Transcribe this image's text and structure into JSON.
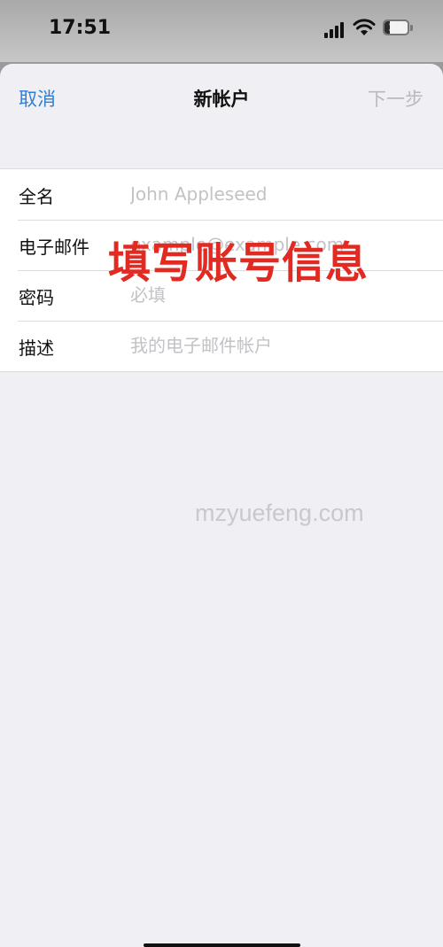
{
  "status_bar": {
    "time": "17:51",
    "battery_level": "24",
    "battery_fraction": 0.24,
    "icons": [
      "signal-icon",
      "wifi-icon",
      "battery-icon"
    ]
  },
  "nav": {
    "cancel_label": "取消",
    "title": "新帐户",
    "next_label": "下一步"
  },
  "form": {
    "rows": [
      {
        "label": "全名",
        "value": "",
        "placeholder": "John Appleseed"
      },
      {
        "label": "电子邮件",
        "value": "",
        "placeholder": "example@example.com"
      },
      {
        "label": "密码",
        "value": "",
        "placeholder": "必填"
      },
      {
        "label": "描述",
        "value": "",
        "placeholder": "我的电子邮件帐户"
      }
    ]
  },
  "annotation": "填写账号信息",
  "watermark": "mzyuefeng.com",
  "colors": {
    "accent": "#2f7fd6",
    "annotation": "#e02a22",
    "disabled": "#b9b9bf",
    "background": "#efeff4"
  }
}
